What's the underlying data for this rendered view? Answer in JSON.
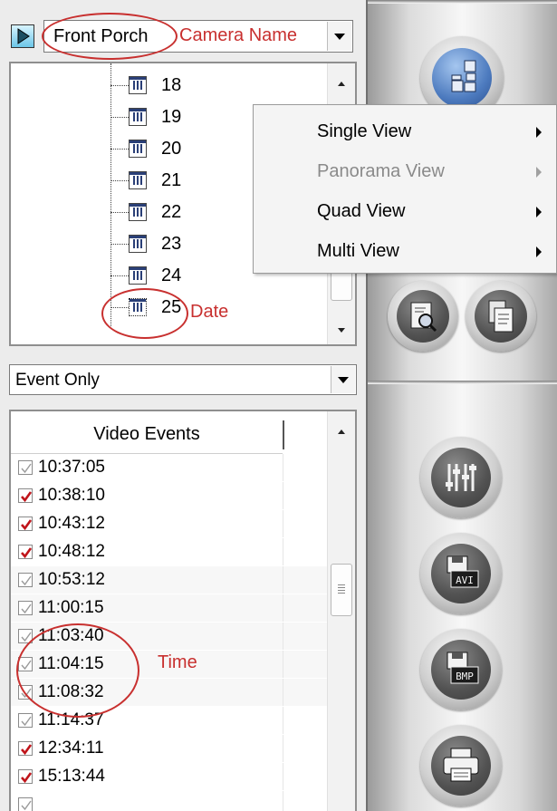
{
  "camera": {
    "name": "Front Porch",
    "annotation": "Camera Name"
  },
  "date_tree": {
    "items": [
      "18",
      "19",
      "20",
      "21",
      "22",
      "23",
      "24",
      "25"
    ],
    "annotation": "Date"
  },
  "filter": {
    "value": "Event Only"
  },
  "events": {
    "header": "Video Events",
    "rows": [
      {
        "time": "10:37:05",
        "checked": false
      },
      {
        "time": "10:38:10",
        "checked": true
      },
      {
        "time": "10:43:12",
        "checked": true
      },
      {
        "time": "10:48:12",
        "checked": true
      },
      {
        "time": "10:53:12",
        "checked": false
      },
      {
        "time": "11:00:15",
        "checked": false
      },
      {
        "time": "11:03:40",
        "checked": false
      },
      {
        "time": "11:04:15",
        "checked": false
      },
      {
        "time": "11:08:32",
        "checked": false
      },
      {
        "time": "11:14:37",
        "checked": false
      },
      {
        "time": "12:34:11",
        "checked": true
      },
      {
        "time": "15:13:44",
        "checked": true
      },
      {
        "time": "",
        "checked": false
      }
    ],
    "annotation": "Time"
  },
  "context_menu": {
    "items": [
      {
        "label": "Single View",
        "disabled": false
      },
      {
        "label": "Panorama View",
        "disabled": true
      },
      {
        "label": "Quad View",
        "disabled": false
      },
      {
        "label": "Multi View",
        "disabled": false
      }
    ]
  },
  "toolbar": {
    "icons": [
      "layout-grid-icon",
      "search-icon",
      "copy-icon",
      "sliders-icon",
      "save-avi-icon",
      "save-bmp-icon",
      "print-icon"
    ],
    "avi_label": "AVI",
    "bmp_label": "BMP"
  },
  "colors": {
    "annotation": "#c8302f",
    "check_red": "#c0141a",
    "check_gray": "#9a9a9a"
  }
}
